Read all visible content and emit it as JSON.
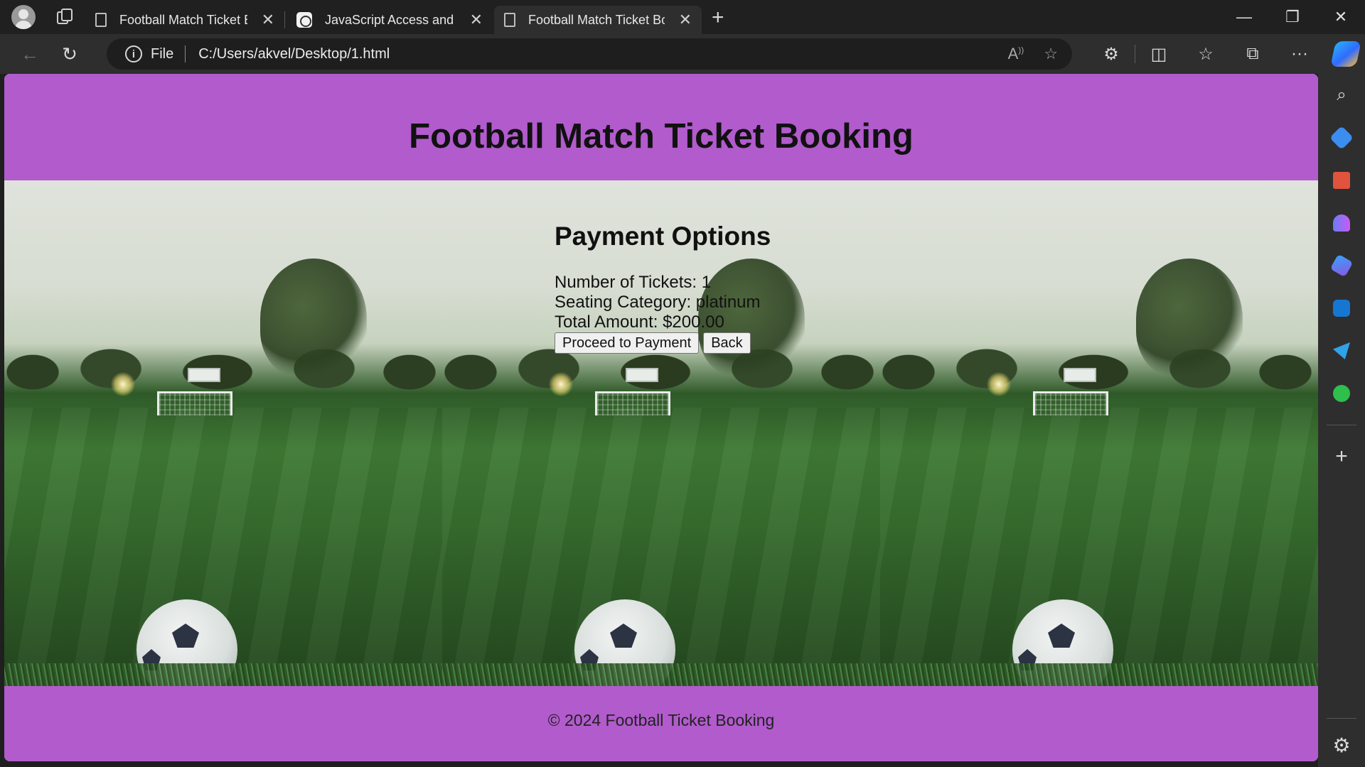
{
  "browser": {
    "tabs": [
      {
        "title": "Football Match Ticket Booking",
        "icon": "page-icon",
        "active": false
      },
      {
        "title": "JavaScript Access and Checks.",
        "icon": "chatgpt-icon",
        "active": false
      },
      {
        "title": "Football Match Ticket Booking",
        "icon": "page-icon",
        "active": true
      }
    ],
    "address": {
      "scheme_label": "File",
      "url": "C:/Users/akvel/Desktop/1.html"
    }
  },
  "page": {
    "header_title": "Football Match Ticket Booking",
    "payment": {
      "heading": "Payment Options",
      "tickets_line": "Number of Tickets: 1",
      "category_line": "Seating Category: platinum",
      "total_line": "Total Amount: $200.00",
      "proceed_label": "Proceed to Payment",
      "back_label": "Back"
    },
    "footer_text": "© 2024 Football Ticket Booking"
  },
  "colors": {
    "header_footer_bg": "#b25bcd",
    "browser_tabbar": "#202020",
    "browser_toolbar": "#2e2e2e"
  }
}
